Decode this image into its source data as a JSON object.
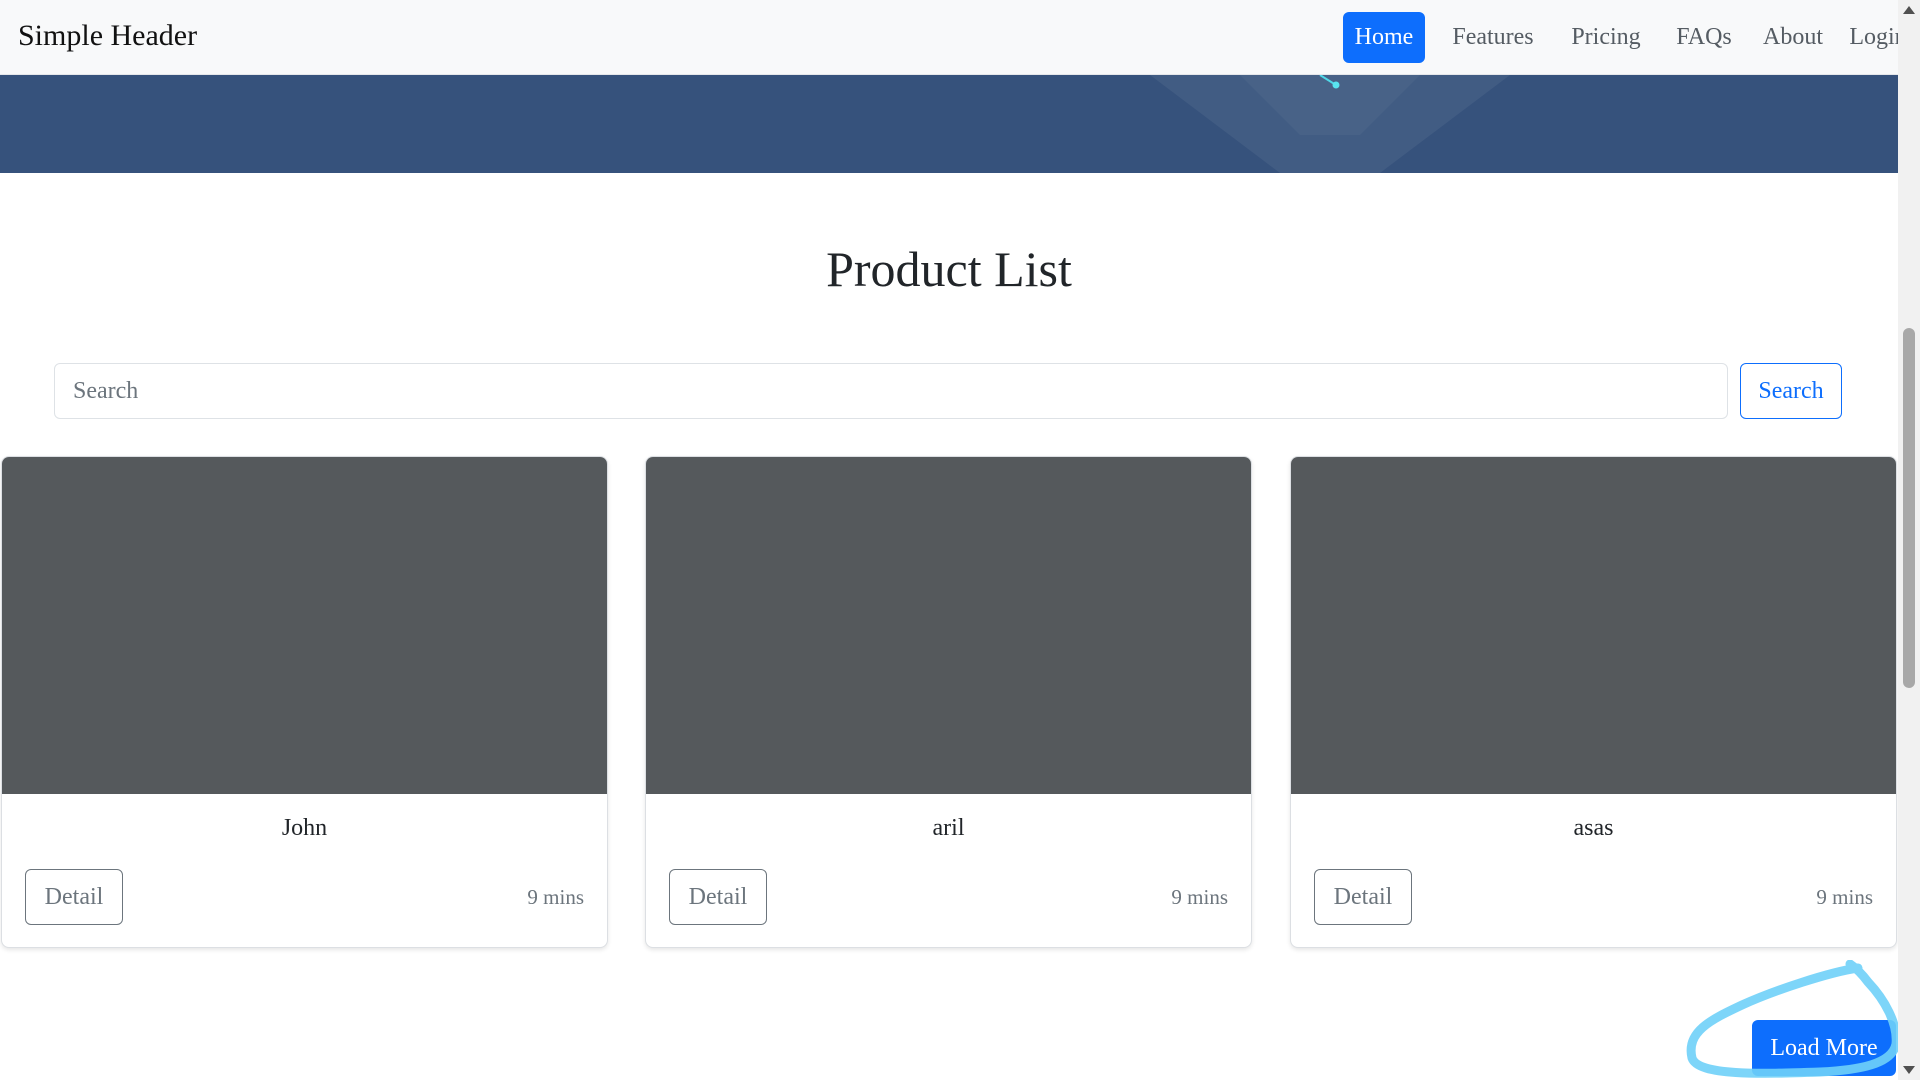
{
  "navbar": {
    "brand": "Simple Header",
    "items": [
      {
        "label": "Home",
        "active": true
      },
      {
        "label": "Features",
        "active": false
      },
      {
        "label": "Pricing",
        "active": false
      },
      {
        "label": "FAQs",
        "active": false
      },
      {
        "label": "About",
        "active": false
      },
      {
        "label": "Login",
        "active": false
      }
    ]
  },
  "main": {
    "title": "Product List",
    "search": {
      "placeholder": "Search",
      "value": "",
      "button_label": "Search"
    },
    "products": [
      {
        "name": "John",
        "button_label": "Detail",
        "time": "9 mins"
      },
      {
        "name": "aril",
        "button_label": "Detail",
        "time": "9 mins"
      },
      {
        "name": "asas",
        "button_label": "Detail",
        "time": "9 mins"
      }
    ],
    "load_more_label": "Load More"
  },
  "colors": {
    "primary": "#0d6efd",
    "hero": "#36527c",
    "card_image": "#55595c",
    "annotation": "#6fd0f8"
  }
}
